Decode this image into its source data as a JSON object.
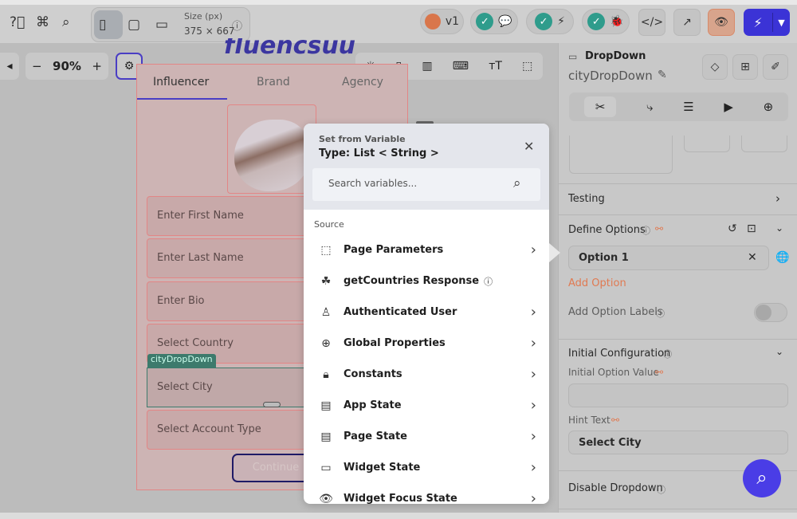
{
  "topbar": {
    "help_icon": "help-circle-icon",
    "command_icon": "command-icon",
    "search_icon": "search-icon",
    "size_label": "Size (px)",
    "size_value": "375 × 667",
    "version": "v1",
    "accent": "#3b33d6"
  },
  "canvas": {
    "zoom": "90%",
    "logo_text": "fluencsuu",
    "tabs": [
      "Influencer",
      "Brand",
      "Agency"
    ],
    "fields": [
      "Enter First Name",
      "Enter Last Name",
      "Enter Bio",
      "Select Country",
      "Select City",
      "Select Account Type"
    ],
    "selected_tag": "cityDropDown",
    "button": "Continue"
  },
  "modal": {
    "subtitle": "Set from Variable",
    "title": "Type: List < String >",
    "search_placeholder": "Search variables...",
    "section": "Source",
    "items": [
      {
        "label": "Page Parameters",
        "icon": "page-parameters-icon",
        "chevron": true
      },
      {
        "label": "getCountries Response",
        "icon": "api-icon",
        "info": true
      },
      {
        "label": "Authenticated User",
        "icon": "user-icon",
        "chevron": true
      },
      {
        "label": "Global Properties",
        "icon": "globe-icon",
        "chevron": true
      },
      {
        "label": "Constants",
        "icon": "lock-icon",
        "chevron": true
      },
      {
        "label": "App State",
        "icon": "app-state-icon",
        "chevron": true
      },
      {
        "label": "Page State",
        "icon": "page-state-icon",
        "chevron": true
      },
      {
        "label": "Widget State",
        "icon": "widget-state-icon",
        "chevron": true
      },
      {
        "label": "Widget Focus State",
        "icon": "eye-icon",
        "chevron": true
      }
    ]
  },
  "panel": {
    "widget_type": "DropDown",
    "widget_name": "cityDropDown",
    "testing": "Testing",
    "define_options": "Define Options",
    "option_1": "Option 1",
    "add_option": "Add Option",
    "add_option_labels": "Add Option Labels",
    "add_option_labels_on": false,
    "initial_configuration": "Initial Configuration",
    "initial_option_value_label": "Initial Option Value",
    "initial_option_value": "",
    "hint_text_label": "Hint Text",
    "hint_text": "Select City",
    "disable_dropdown": "Disable Dropdown"
  }
}
